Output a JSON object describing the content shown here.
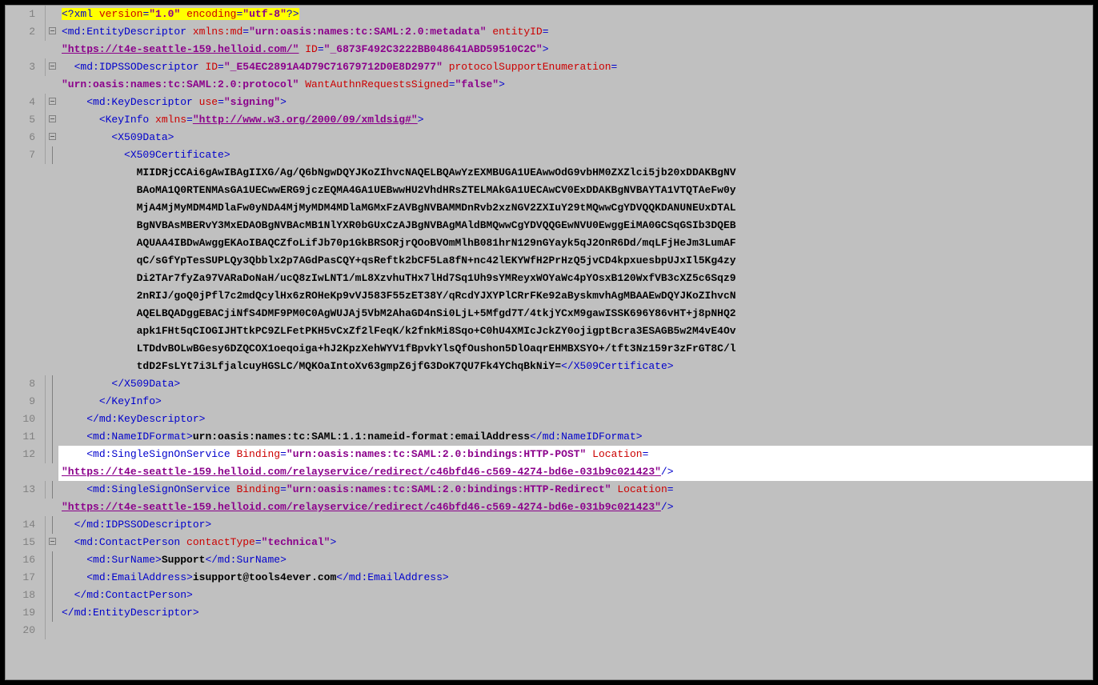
{
  "lines": {
    "l1": "1",
    "l2": "2",
    "l3": "3",
    "l4": "4",
    "l5": "5",
    "l6": "6",
    "l7": "7",
    "l8": "8",
    "l9": "9",
    "l10": "10",
    "l11": "11",
    "l12": "12",
    "l13": "13",
    "l14": "14",
    "l15": "15",
    "l16": "16",
    "l17": "17",
    "l18": "18",
    "l19": "19",
    "l20": "20"
  },
  "xml": {
    "decl_open": "<?",
    "decl_xml": "xml",
    "decl_ver_attr": " version",
    "decl_ver_val": "\"1.0\"",
    "decl_enc_attr": " encoding",
    "decl_enc_val": "\"utf-8\"",
    "decl_close": "?>",
    "eq": "=",
    "entity_open": "<md:EntityDescriptor",
    "xmlns_md_attr": " xmlns:md",
    "xmlns_md_val": "\"urn:oasis:names:tc:SAML:2.0:metadata\"",
    "entityid_attr": " entityID",
    "entityid_val": "\"https://t4e-seattle-159.helloid.com/\"",
    "id_attr": " ID",
    "entity_id_val": "\"_6873F492C3222BB048641ABD59510C2C\"",
    "tag_close": ">",
    "selfclose": "/>",
    "idpsso_open": "  <md:IDPSSODescriptor",
    "idpsso_id_val": "\"_E54EC2891A4D79C71679712D0E8D2977\"",
    "proto_attr": " protocolSupportEnumeration",
    "proto_val": "\"urn:oasis:names:tc:SAML:2.0:protocol\"",
    "wantauth_attr": " WantAuthnRequestsSigned",
    "wantauth_val": "\"false\"",
    "keydesc_open": "    <md:KeyDescriptor",
    "use_attr": " use",
    "use_val": "\"signing\"",
    "keyinfo_open": "      <KeyInfo",
    "xmlns_attr": " xmlns",
    "xmlns_val": "\"http://www.w3.org/2000/09/xmldsig#\"",
    "x509data_open": "        <X509Data>",
    "x509cert_open": "          <X509Certificate>",
    "cert": "            MIIDRjCCAi6gAwIBAgIIXG/Ag/Q6bNgwDQYJKoZIhvcNAQELBQAwYzEXMBUGA1UEAwwOdG9vbHM0ZXZlci5jb20xDDAKBgNV\n            BAoMA1Q0RTENMAsGA1UECwwERG9jczEQMA4GA1UEBwwHU2VhdHRsZTELMAkGA1UECAwCV0ExDDAKBgNVBAYTA1VTQTAeFw0y\n            MjA4MjMyMDM4MDlaFw0yNDA4MjMyMDM4MDlaMGMxFzAVBgNVBAMMDnRvb2xzNGV2ZXIuY29tMQwwCgYDVQQKDANUNEUxDTAL\n            BgNVBAsMBERvY3MxEDAOBgNVBAcMB1NlYXR0bGUxCzAJBgNVBAgMAldBMQwwCgYDVQQGEwNVU0EwggEiMA0GCSqGSIb3DQEB\n            AQUAA4IBDwAwggEKAoIBAQCZfoLifJb70p1GkBRSORjrQOoBVOmMlhB081hrN129nGYayk5qJ2OnR6Dd/mqLFjHeJm3LumAF\n            qC/sGfYpTesSUPLQy3Qbblx2p7AGdPasCQY+qsReftk2bCF5La8fN+nc42lEKYWfH2PrHzQ5jvCD4kpxuesbpUJxIl5Kg4zy\n            Di2TAr7fyZa97VARaDoNaH/ucQ8zIwLNT1/mL8XzvhuTHx7lHd7Sq1Uh9sYMReyxWOYaWc4pYOsxB120WxfVB3cXZ5c6Sqz9\n            2nRIJ/goQ0jPfl7c2mdQcylHx6zROHeKp9vVJ583F55zET38Y/qRcdYJXYPlCRrFKe92aByskmvhAgMBAAEwDQYJKoZIhvcN\n            AQELBQADggEBACjiNfS4DMF9PM0C0AgWUJAj5VbM2AhaGD4nSi0LjL+5Mfgd7T/4tkjYCxM9gawISSK696Y86vHT+j8pNHQ2\n            apk1FHt5qCIOGIJHTtkPC9ZLFetPKH5vCxZf2lFeqK/k2fnkMi8Sqo+C0hU4XMIcJckZY0ojigptBcra3ESAGB5w2M4vE4Ov\n            LTDdvBOLwBGesy6DZQCOX1oeqoiga+hJ2KpzXehWYV1fBpvkYlsQfOushon5DlOaqrEHMBXSYO+/tft3Nz159r3zFrGT8C/l\n            tdD2FsLYt7i3LfjalcuyHGSLC/MQKOaIntoXv63gmpZ6jfG3DoK7QU7Fk4YChqBkNiY=",
    "x509cert_close": "</X509Certificate>",
    "x509data_close": "        </X509Data>",
    "keyinfo_close": "      </KeyInfo>",
    "keydesc_close": "    </md:KeyDescriptor>",
    "nameid_open": "    <md:NameIDFormat>",
    "nameid_txt": "urn:oasis:names:tc:SAML:1.1:nameid-format:emailAddress",
    "nameid_close": "</md:NameIDFormat>",
    "sso_open": "    <md:SingleSignOnService",
    "binding_attr": " Binding",
    "binding_post": "\"urn:oasis:names:tc:SAML:2.0:bindings:HTTP-POST\"",
    "binding_redirect": "\"urn:oasis:names:tc:SAML:2.0:bindings:HTTP-Redirect\"",
    "location_attr": " Location",
    "location_val": "\"https://t4e-seattle-159.helloid.com/relayservice/redirect/c46bfd46-c569-4274-bd6e-031b9c021423\"",
    "idpsso_close": "  </md:IDPSSODescriptor>",
    "contact_open": "  <md:ContactPerson",
    "contacttype_attr": " contactType",
    "contacttype_val": "\"technical\"",
    "surname_open": "    <md:SurName>",
    "surname_txt": "Support",
    "surname_close": "</md:SurName>",
    "email_open": "    <md:EmailAddress>",
    "email_txt": "isupport@tools4ever.com",
    "email_close": "</md:EmailAddress>",
    "contact_close": "  </md:ContactPerson>",
    "entity_close": "</md:EntityDescriptor>"
  }
}
